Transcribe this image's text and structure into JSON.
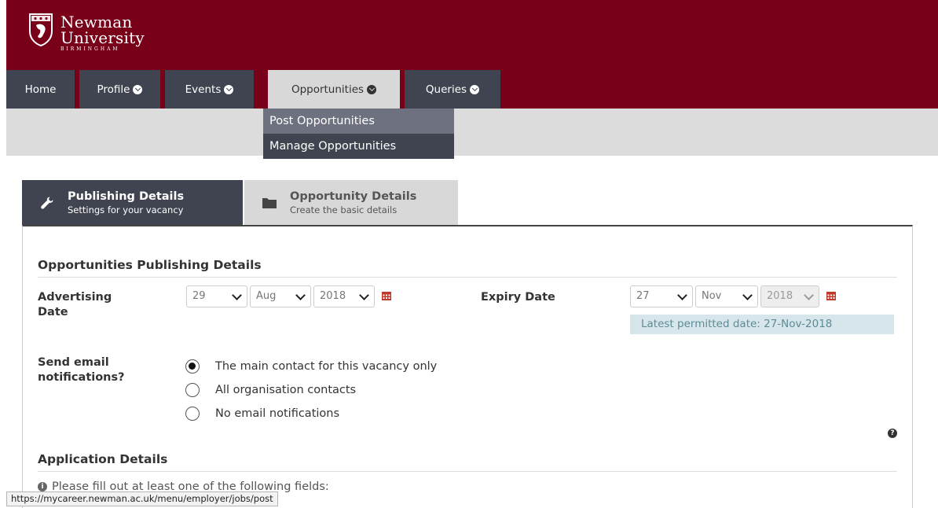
{
  "brand": {
    "name_line1": "Newman",
    "name_line2": "University",
    "name_line3": "BIRMINGHAM",
    "color": "#780019",
    "logo_icon": "crest-icon"
  },
  "nav": {
    "items": [
      {
        "label": "Home",
        "has_dropdown": false
      },
      {
        "label": "Profile",
        "has_dropdown": true
      },
      {
        "label": "Events",
        "has_dropdown": true
      },
      {
        "label": "Opportunities",
        "has_dropdown": true,
        "active": true
      },
      {
        "label": "Queries",
        "has_dropdown": true
      }
    ],
    "dropdown": [
      "Post Opportunities",
      "Manage Opportunities"
    ]
  },
  "tabs": [
    {
      "title": "Publishing Details",
      "subtitle": "Settings for your vacancy",
      "icon": "wrench-icon",
      "active": true
    },
    {
      "title": "Opportunity Details",
      "subtitle": "Create the basic details",
      "icon": "folder-icon",
      "active": false
    }
  ],
  "publishing": {
    "section_title": "Opportunities Publishing Details",
    "advertising_label_1": "Advertising",
    "advertising_label_2": "Date",
    "advertising": {
      "day": "29",
      "month": "Aug",
      "year": "2018"
    },
    "expiry_label": "Expiry Date",
    "expiry": {
      "day": "27",
      "month": "Nov",
      "year": "2018"
    },
    "latest_permitted": "Latest permitted date: 27-Nov-2018",
    "email_label_1": "Send email",
    "email_label_2": "notifications?",
    "email_options": [
      {
        "label": "The main contact for this vacancy only",
        "selected": true
      },
      {
        "label": "All organisation contacts",
        "selected": false
      },
      {
        "label": "No email notifications",
        "selected": false
      }
    ]
  },
  "application": {
    "section_title": "Application Details",
    "hint": "Please fill out at least one of the following fields:"
  },
  "status_url": "https://mycareer.newman.ac.uk/menu/employer/jobs/post"
}
